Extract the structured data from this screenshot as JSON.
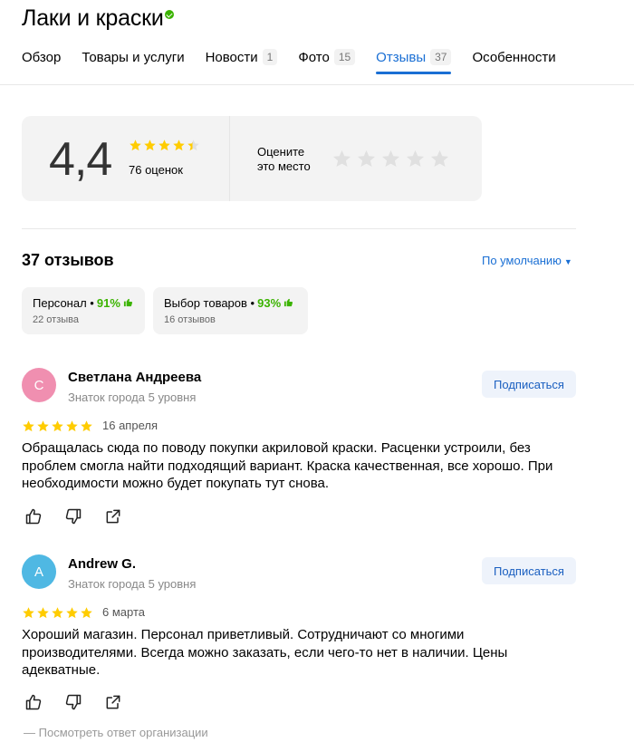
{
  "header": {
    "title": "Лаки и краски",
    "tabs": [
      {
        "label": "Обзор",
        "count": ""
      },
      {
        "label": "Товары и услуги",
        "count": ""
      },
      {
        "label": "Новости",
        "count": "1"
      },
      {
        "label": "Фото",
        "count": "15"
      },
      {
        "label": "Отзывы",
        "count": "37",
        "active": true
      },
      {
        "label": "Особенности",
        "count": ""
      }
    ]
  },
  "rating": {
    "value": "4,4",
    "stars_value": 4.4,
    "count_label": "76 оценок",
    "rate_prompt_line1": "Оцените",
    "rate_prompt_line2": "это место"
  },
  "reviews_section": {
    "count_label": "37 отзывов",
    "sort_label": "По умолчанию",
    "aspects": [
      {
        "name": "Персонал",
        "percent": "91%",
        "sub": "22 отзыва"
      },
      {
        "name": "Выбор товаров",
        "percent": "93%",
        "sub": "16 отзывов"
      }
    ]
  },
  "reviews": [
    {
      "initial": "С",
      "avatar_color": "#f08fb0",
      "name": "Светлана Андреева",
      "level": "Знаток города 5 уровня",
      "subscribe_label": "Подписаться",
      "stars": 5,
      "date": "16 апреля",
      "text": "Обращалась сюда по поводу покупки акриловой краски. Расценки устроили, без проблем смогла найти подходящий вариант. Краска качественная, все хорошо. При необходимости можно будет покупать тут снова."
    },
    {
      "initial": "A",
      "avatar_color": "#4fb8e3",
      "name": "Andrew G.",
      "level": "Знаток города 5 уровня",
      "subscribe_label": "Подписаться",
      "stars": 5,
      "date": "6 марта",
      "text": "Хороший магазин. Персонал приветливый. Сотрудничают со многими производителями. Всегда можно заказать, если чего-то нет в наличии. Цены адекватные.",
      "org_reply_label": "Посмотреть ответ организации"
    }
  ],
  "colors": {
    "accent": "#1a6fd4",
    "star": "#fc0",
    "star_empty": "#e0e0e0",
    "positive": "#3bb300"
  },
  "icons": [
    "verified-icon",
    "star-icon",
    "thumb-up-icon",
    "thumb-down-icon",
    "share-icon",
    "caret-down-icon"
  ]
}
